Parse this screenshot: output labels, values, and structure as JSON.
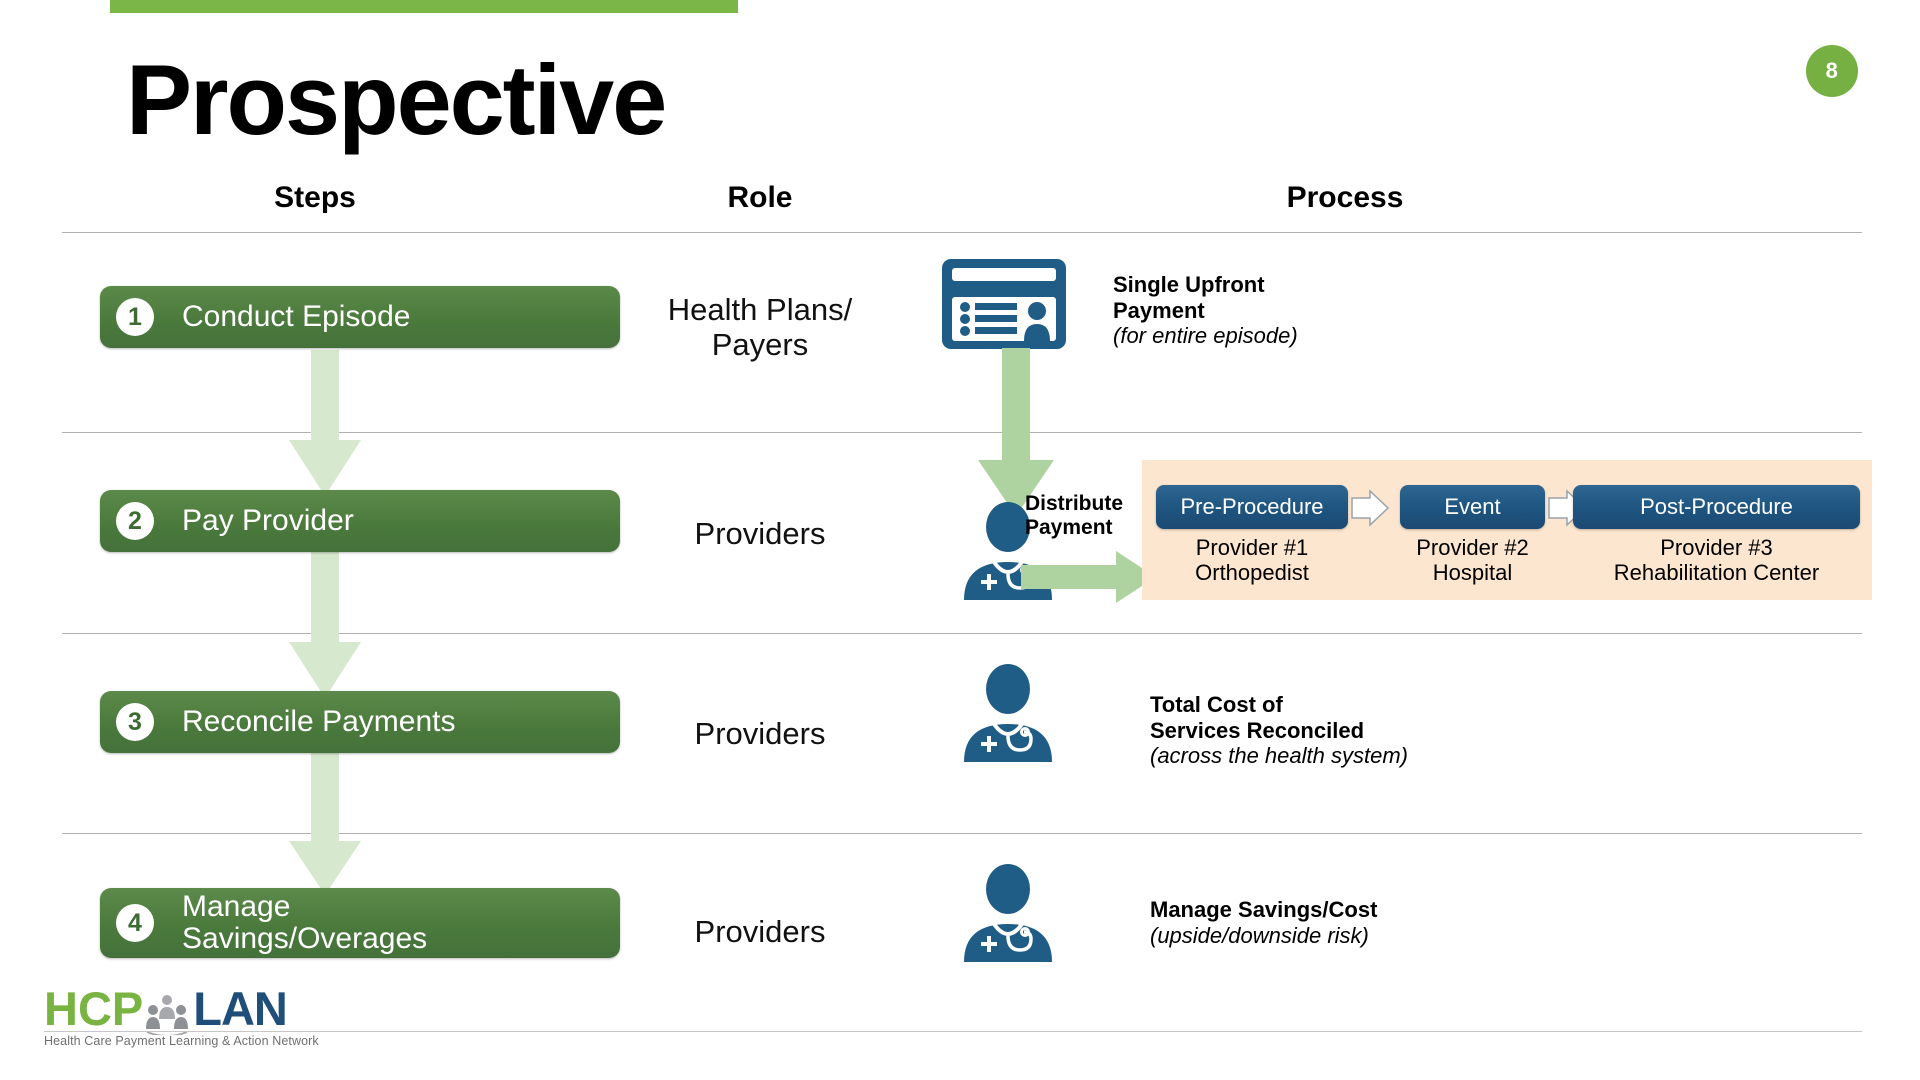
{
  "slide": {
    "title": "Prospective",
    "page_number": "8",
    "accent_green": "#7ab648",
    "box_green": "#4b7a3c",
    "process_blue": "#1e5480",
    "band_peach": "#fce6cf",
    "arrow_light_green": "#d6e8cd"
  },
  "columns": {
    "steps": "Steps",
    "role": "Role",
    "process": "Process"
  },
  "rows": [
    {
      "number": "1",
      "step": "Conduct Episode",
      "role": "Health Plans/\nPayers",
      "process_bold": "Single Upfront\nPayment",
      "process_italic": "(for entire episode)",
      "icon": "insurance-card-icon"
    },
    {
      "number": "2",
      "step": "Pay Provider",
      "role": "Providers",
      "process_bold": "Distribute\nPayment",
      "process_italic": "",
      "icon": "doctor-icon"
    },
    {
      "number": "3",
      "step": "Reconcile Payments",
      "role": "Providers",
      "process_bold": "Total Cost of\nServices Reconciled",
      "process_italic": "(across the health system)",
      "icon": "doctor-icon"
    },
    {
      "number": "4",
      "step": "Manage\nSavings/Overages",
      "role": "Providers",
      "process_bold": "Manage Savings/Cost",
      "process_italic": "(upside/downside risk)",
      "icon": "doctor-icon"
    }
  ],
  "episode_flow": {
    "chips": [
      {
        "label": "Pre-Procedure",
        "sub": "Provider #1\nOrthopedist"
      },
      {
        "label": "Event",
        "sub": "Provider #2\nHospital"
      },
      {
        "label": "Post-Procedure",
        "sub": "Provider #3\nRehabilitation Center"
      }
    ]
  },
  "logo": {
    "hcp": "HCP",
    "lan": "LAN",
    "tagline": "Health Care Payment Learning & Action Network"
  }
}
